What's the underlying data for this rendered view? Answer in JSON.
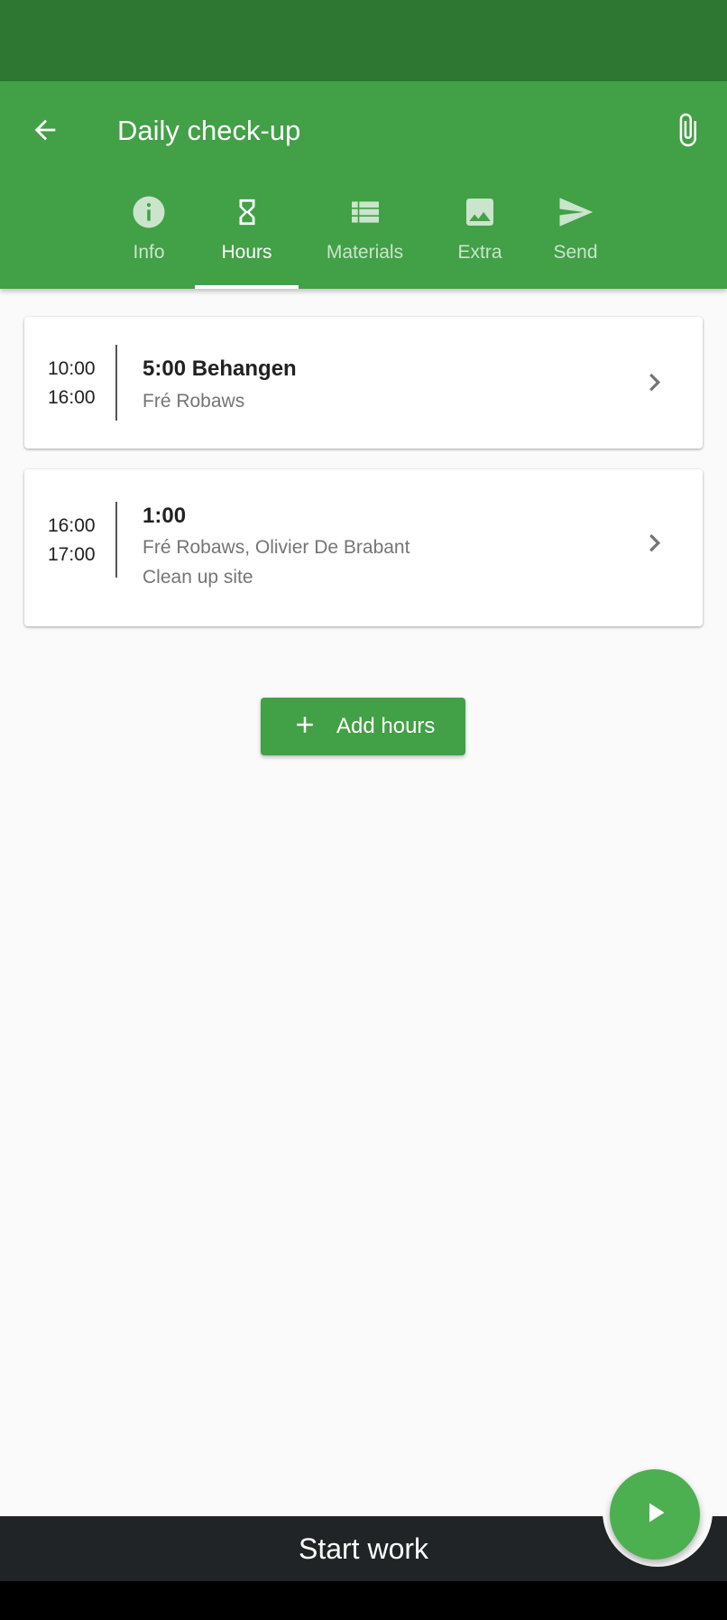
{
  "header": {
    "title": "Daily check-up",
    "back_icon": "arrow-left-icon",
    "attach_icon": "paperclip-icon"
  },
  "tabs": [
    {
      "label": "Info",
      "icon": "info-icon",
      "active": false
    },
    {
      "label": "Hours",
      "icon": "hourglass-icon",
      "active": true
    },
    {
      "label": "Materials",
      "icon": "list-icon",
      "active": false
    },
    {
      "label": "Extra",
      "icon": "image-icon",
      "active": false
    },
    {
      "label": "Send",
      "icon": "send-icon",
      "active": false
    }
  ],
  "entries": [
    {
      "start": "10:00",
      "end": "16:00",
      "title": "5:00 Behangen",
      "people": "Fré Robaws",
      "note": ""
    },
    {
      "start": "16:00",
      "end": "17:00",
      "title": "1:00",
      "people": "Fré Robaws, Olivier De Brabant",
      "note": "Clean up site"
    }
  ],
  "add_button": {
    "label": "Add hours",
    "icon": "plus-icon"
  },
  "bottom": {
    "label": "Start work",
    "fab_icon": "play-icon"
  },
  "colors": {
    "primary": "#42a046",
    "primary_dark": "#2e7732",
    "fab": "#4caf50",
    "bottom_bar": "#212427"
  }
}
